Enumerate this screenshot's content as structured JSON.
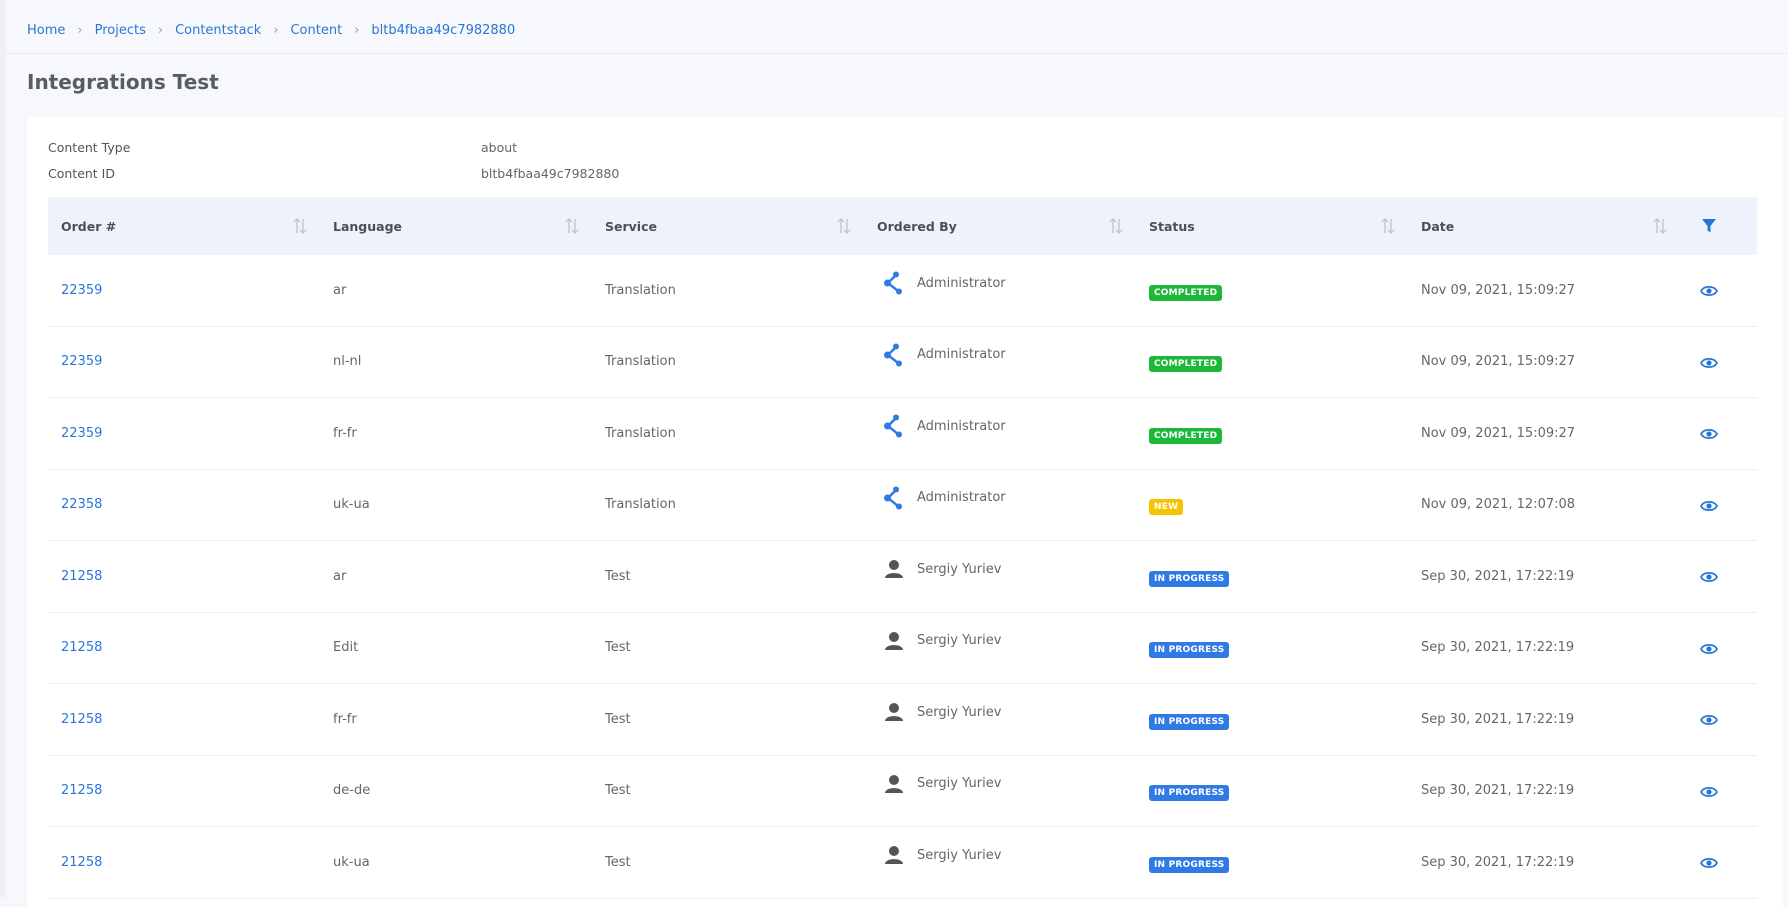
{
  "breadcrumb": [
    {
      "label": "Home"
    },
    {
      "label": "Projects"
    },
    {
      "label": "Contentstack"
    },
    {
      "label": "Content"
    },
    {
      "label": "bltb4fbaa49c7982880"
    }
  ],
  "page_title": "Integrations Test",
  "meta": {
    "content_type_label": "Content Type",
    "content_type_value": "about",
    "content_id_label": "Content ID",
    "content_id_value": "bltb4fbaa49c7982880"
  },
  "table": {
    "columns": [
      "Order #",
      "Language",
      "Service",
      "Ordered By",
      "Status",
      "Date"
    ],
    "rows": [
      {
        "order": "22359",
        "language": "ar",
        "service": "Translation",
        "ordered_by": "Administrator",
        "orderer_icon": "share-icon",
        "status": "COMPLETED",
        "date": "Nov 09, 2021, 15:09:27"
      },
      {
        "order": "22359",
        "language": "nl-nl",
        "service": "Translation",
        "ordered_by": "Administrator",
        "orderer_icon": "share-icon",
        "status": "COMPLETED",
        "date": "Nov 09, 2021, 15:09:27"
      },
      {
        "order": "22359",
        "language": "fr-fr",
        "service": "Translation",
        "ordered_by": "Administrator",
        "orderer_icon": "share-icon",
        "status": "COMPLETED",
        "date": "Nov 09, 2021, 15:09:27"
      },
      {
        "order": "22358",
        "language": "uk-ua",
        "service": "Translation",
        "ordered_by": "Administrator",
        "orderer_icon": "share-icon",
        "status": "NEW",
        "date": "Nov 09, 2021, 12:07:08"
      },
      {
        "order": "21258",
        "language": "ar",
        "service": "Test",
        "ordered_by": "Sergiy Yuriev",
        "orderer_icon": "user-icon",
        "status": "IN PROGRESS",
        "date": "Sep 30, 2021, 17:22:19"
      },
      {
        "order": "21258",
        "language": "Edit",
        "service": "Test",
        "ordered_by": "Sergiy Yuriev",
        "orderer_icon": "user-icon",
        "status": "IN PROGRESS",
        "date": "Sep 30, 2021, 17:22:19"
      },
      {
        "order": "21258",
        "language": "fr-fr",
        "service": "Test",
        "ordered_by": "Sergiy Yuriev",
        "orderer_icon": "user-icon",
        "status": "IN PROGRESS",
        "date": "Sep 30, 2021, 17:22:19"
      },
      {
        "order": "21258",
        "language": "de-de",
        "service": "Test",
        "ordered_by": "Sergiy Yuriev",
        "orderer_icon": "user-icon",
        "status": "IN PROGRESS",
        "date": "Sep 30, 2021, 17:22:19"
      },
      {
        "order": "21258",
        "language": "uk-ua",
        "service": "Test",
        "ordered_by": "Sergiy Yuriev",
        "orderer_icon": "user-icon",
        "status": "IN PROGRESS",
        "date": "Sep 30, 2021, 17:22:19"
      }
    ]
  },
  "colors": {
    "link": "#2a76d6",
    "completed": "#1db83a",
    "new": "#f5c400",
    "in_progress": "#2f7ae5",
    "header_bg": "#eef2fb"
  }
}
